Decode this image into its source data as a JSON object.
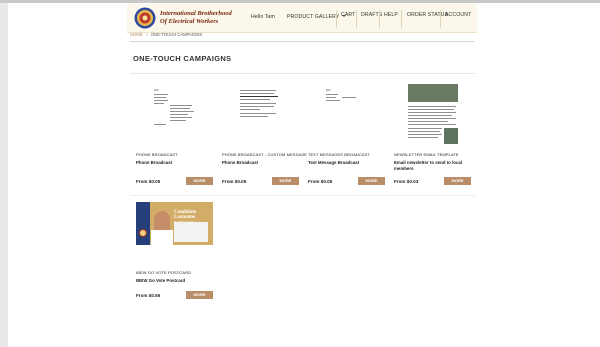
{
  "header": {
    "brand_line1": "International Brotherhood",
    "brand_line2": "Of Electrical Workers",
    "greeting": "Hello Tam",
    "nav": {
      "product_gallery": "PRODUCT GALLERY",
      "cart": "CART",
      "drafts": "DRAFTS",
      "help": "HELP",
      "order_status": "ORDER STATUS",
      "account": "ACCOUNT"
    }
  },
  "breadcrumb": {
    "home": "HOME",
    "separator": "»",
    "current": "ONE-TOUCH CAMPAIGNS"
  },
  "page_title": "ONE-TOUCH CAMPAIGNS",
  "more_label": "MORE",
  "products": [
    {
      "category": "PHONE BROADCAST",
      "name": "Phone Broadcast",
      "price": "From $0.05"
    },
    {
      "category": "PHONE BROADCAST - CUSTOM MESSAGE",
      "name": "Phone Broadcast",
      "price": "From $0.05"
    },
    {
      "category": "TEXT MESSAGES BROADCAST",
      "name": "Text Message Broadcast",
      "price": "From $0.05"
    },
    {
      "category": "NEWSLETTER EMAIL TEMPLATE",
      "name": "Email newsletter to send to local members",
      "price": "From $0.03"
    },
    {
      "category": "IBEW GO VOTE POSTCARD",
      "name": "IBEW Go Vote Postcard",
      "price": "From $0.65"
    }
  ],
  "postcard_thumb": {
    "headline_1": "Candidate",
    "headline_2": "Lastname",
    "subline": "For Office Name"
  },
  "icons": {
    "logo": "ibew-seal-icon",
    "dropdown": "chevron-down-icon"
  },
  "colors": {
    "brand_text": "#7a2412",
    "header_bg": "#fbf7ea",
    "button_bg": "#b98d67",
    "breadcrumb_link": "#b5845a"
  }
}
